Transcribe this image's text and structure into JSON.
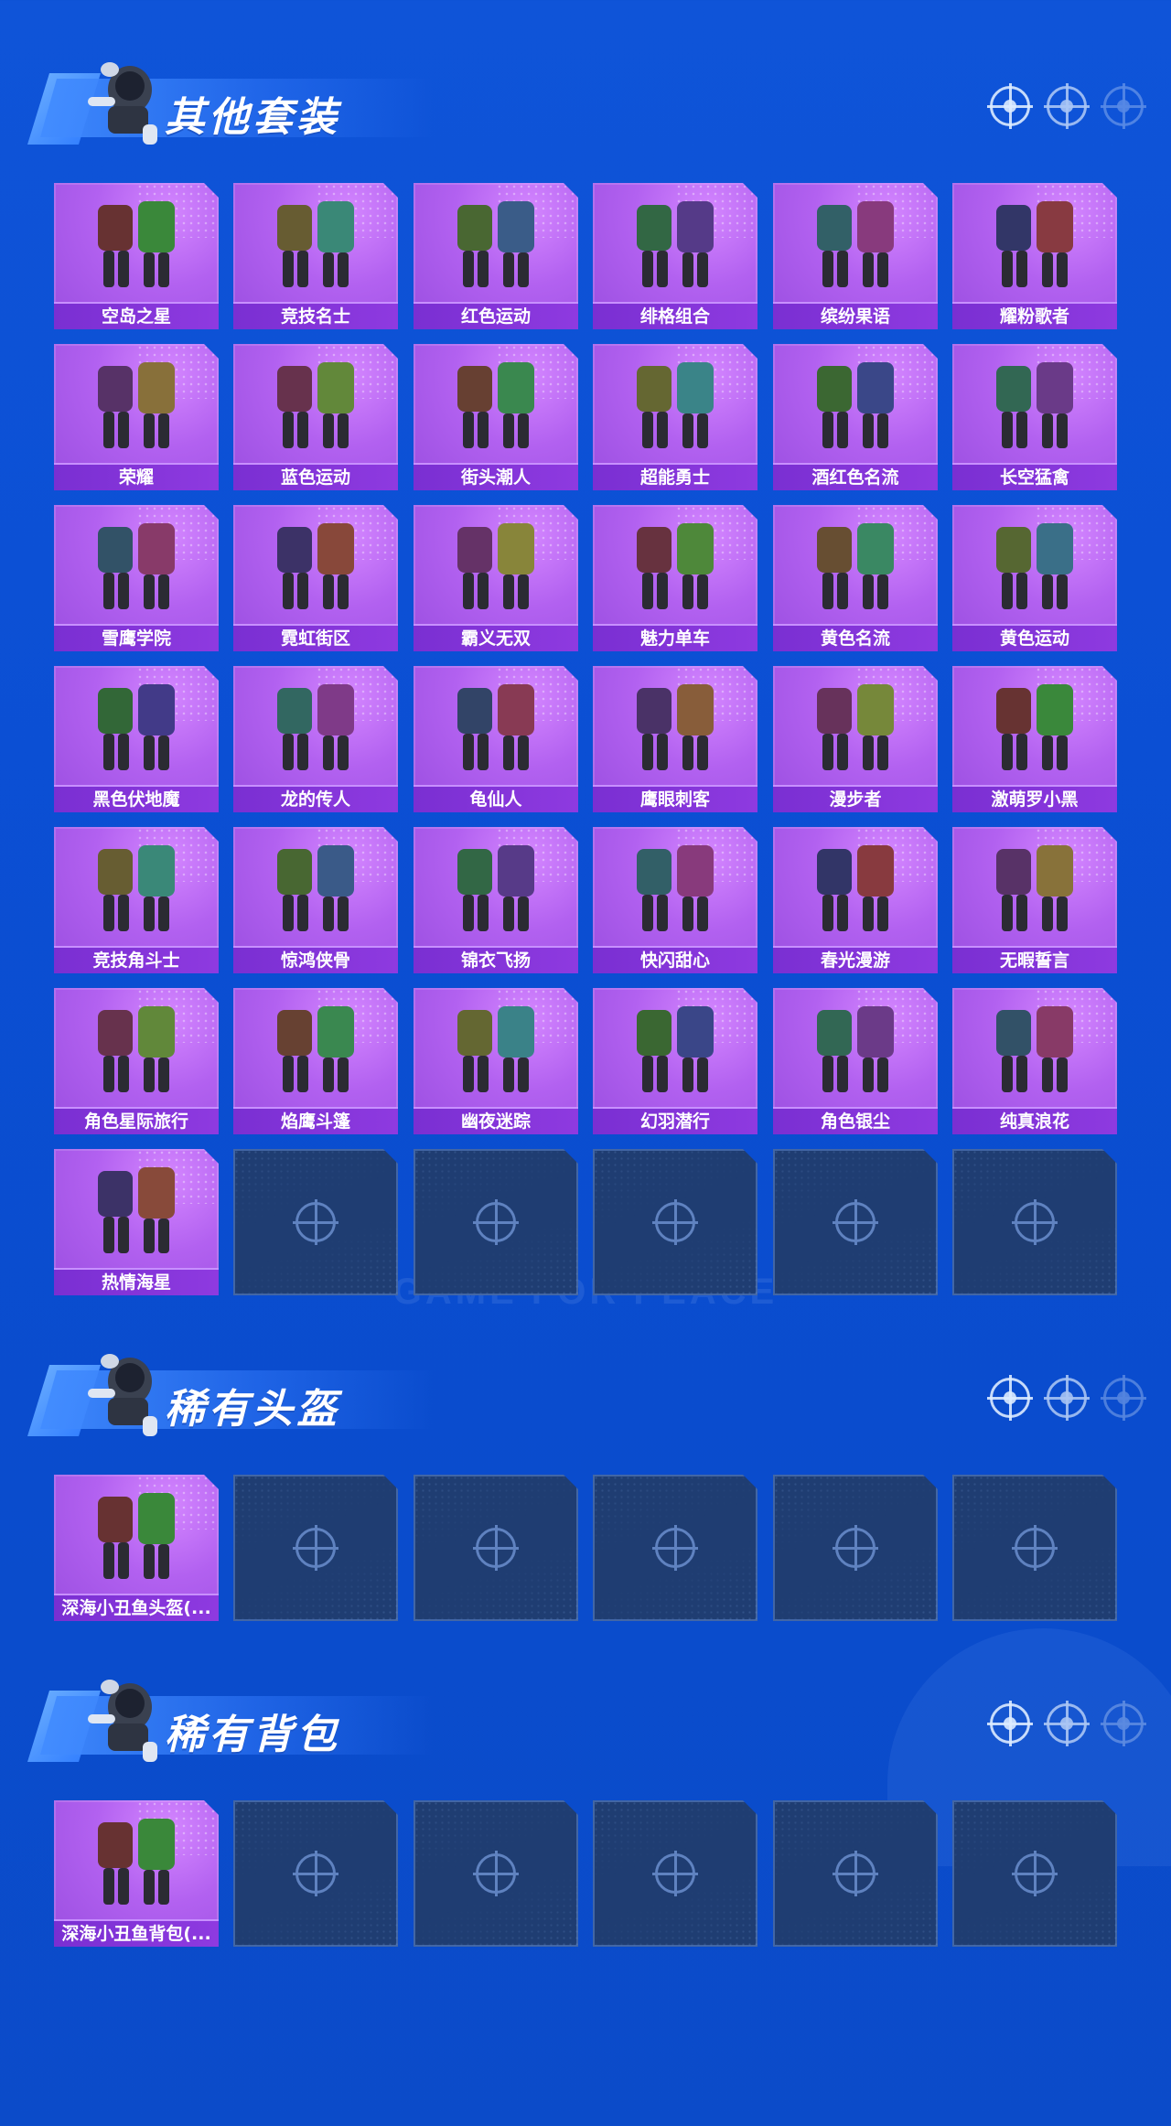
{
  "background": {
    "watermark_text": "GAME FOR PEACE"
  },
  "sections": [
    {
      "title": "其他套装",
      "items": [
        "空岛之星",
        "竞技名士",
        "红色运动",
        "绯格组合",
        "缤纷果语",
        "耀粉歌者",
        "荣耀",
        "蓝色运动",
        "街头潮人",
        "超能勇士",
        "酒红色名流",
        "长空猛禽",
        "雪鹰学院",
        "霓虹街区",
        "霸义无双",
        "魅力单车",
        "黄色名流",
        "黄色运动",
        "黑色伏地魔",
        "龙的传人",
        "龟仙人",
        "鹰眼刺客",
        "漫步者",
        "激萌罗小黑",
        "竞技角斗士",
        "惊鸿侠骨",
        "锦衣飞扬",
        "快闪甜心",
        "春光漫游",
        "无暇誓言",
        "角色星际旅行",
        "焰鹰斗篷",
        "幽夜迷踪",
        "幻羽潜行",
        "角色银尘",
        "纯真浪花",
        "热情海星"
      ],
      "total_slots": 42
    },
    {
      "title": "稀有头盔",
      "items": [
        "深海小丑鱼头盔(..."
      ],
      "total_slots": 6
    },
    {
      "title": "稀有背包",
      "items": [
        "深海小丑鱼背包(..."
      ],
      "total_slots": 6
    }
  ],
  "colors": {
    "background": "#0b4fd4",
    "card_filled": "#b261f0",
    "card_label": "#7a2fd2",
    "card_empty": "#1f3d72"
  },
  "icons": {
    "section_decor": "crosshair-icon",
    "empty_slot": "crosshair-icon"
  }
}
